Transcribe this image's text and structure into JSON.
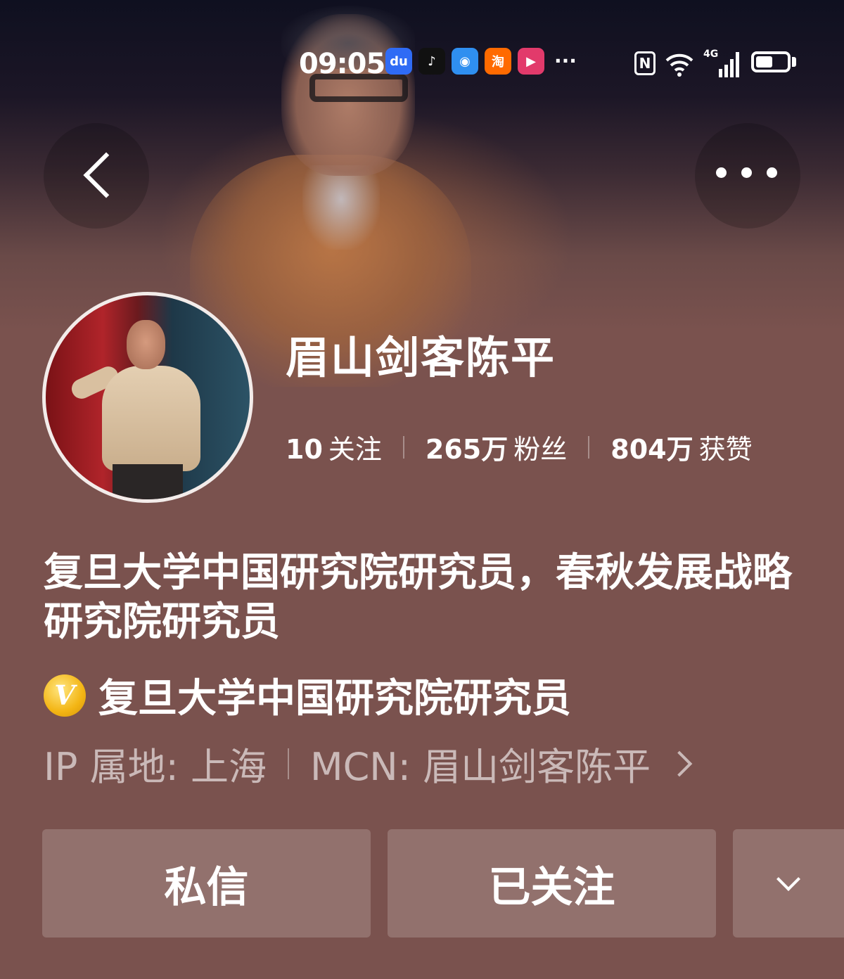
{
  "status_bar": {
    "time": "09:05",
    "apps": [
      {
        "icon": "baidu-icon",
        "label": "du",
        "color": "#2f6bf5"
      },
      {
        "icon": "tiktok-icon",
        "label": "♪",
        "color": "#111111"
      },
      {
        "icon": "browser-icon",
        "label": "◉",
        "color": "#2f8ff0"
      },
      {
        "icon": "taobao-icon",
        "label": "淘",
        "color": "#ff6a00"
      },
      {
        "icon": "video-app-icon",
        "label": "▶",
        "color": "#e23a6b"
      }
    ],
    "more": "···",
    "nfc": "N",
    "wifi": "6+",
    "network": "4G",
    "battery_level": 0.55
  },
  "profile": {
    "name": "眉山剑客陈平",
    "stats": [
      {
        "num": "10",
        "label": "关注"
      },
      {
        "num": "265万",
        "label": "粉丝"
      },
      {
        "num": "804万",
        "label": "获赞"
      }
    ],
    "bio": "复旦大学中国研究院研究员，春秋发展战略研究院研究员",
    "verification": {
      "badge": "V",
      "text": "复旦大学中国研究院研究员"
    },
    "ip_location": "IP 属地: 上海",
    "mcn": "MCN: 眉山剑客陈平"
  },
  "actions": {
    "message": "私信",
    "following": "已关注"
  }
}
